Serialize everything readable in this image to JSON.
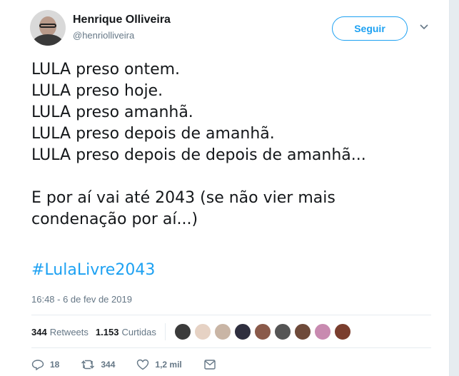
{
  "author": {
    "name": "Henrique Olliveira",
    "handle": "@henriolliveira"
  },
  "follow_label": "Seguir",
  "tweet": {
    "text": "LULA preso ontem.\nLULA preso hoje.\nLULA preso amanhã.\nLULA preso depois de amanhã.\nLULA preso depois de depois de amanhã...\n\nE por aí vai até 2043 (se não vier mais condenação por aí...)",
    "hashtag": "#LulaLivre2043",
    "timestamp": "16:48 - 6 de fev de 2019"
  },
  "stats": {
    "retweets_count": "344",
    "retweets_label": "Retweets",
    "likes_count": "1.153",
    "likes_label": "Curtidas",
    "liker_avatars": [
      "#3b3b3b",
      "#e6d2c4",
      "#c9b5a5",
      "#2f2f3f",
      "#8a5a4a",
      "#555555",
      "#6e4a3a",
      "#c88ab0",
      "#7a3e2e"
    ]
  },
  "actions": {
    "replies": "18",
    "retweets": "344",
    "likes": "1,2 mil"
  },
  "colors": {
    "accent": "#1da1f2",
    "secondary_text": "#657786"
  },
  "icons": [
    "chevron-down-icon",
    "reply-icon",
    "retweet-icon",
    "like-icon",
    "message-icon"
  ]
}
